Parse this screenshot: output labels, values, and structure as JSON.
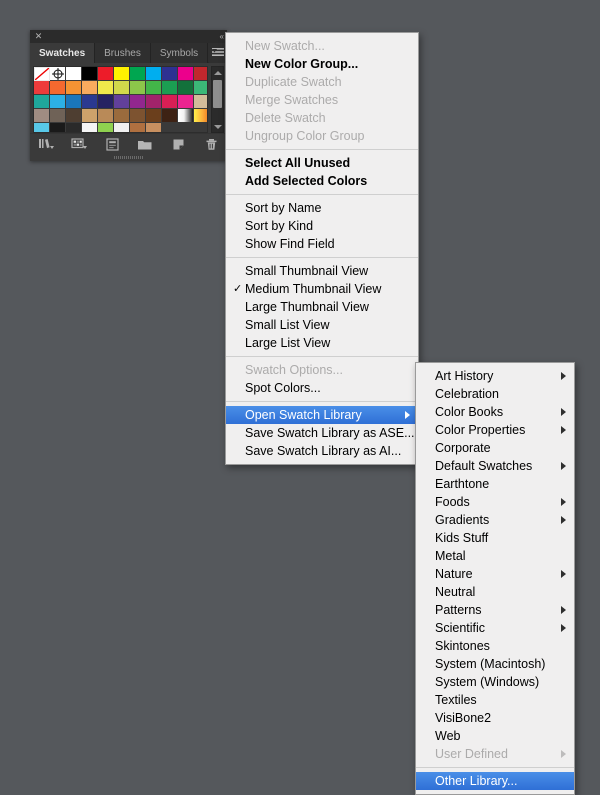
{
  "app": {
    "background_color": "#55585c"
  },
  "panel": {
    "title": "Swatches",
    "close_icon": "close-icon",
    "collapse_icon": "collapse-panel-icon",
    "collapse_glyph": "«",
    "close_glyph": "✕",
    "tabs": [
      {
        "label": "Swatches",
        "active": true
      },
      {
        "label": "Brushes",
        "active": false
      },
      {
        "label": "Symbols",
        "active": false
      }
    ],
    "menu_button_icon": "panel-menu-icon",
    "scrollbar": {
      "up_arrow_icon": "scroll-up-arrow-icon",
      "down_arrow_icon": "scroll-down-arrow-icon",
      "thumb_icon": "scrollbar-thumb"
    },
    "footer_icons": [
      {
        "name": "swatch-libraries-menu-icon"
      },
      {
        "name": "show-swatch-kinds-menu-icon"
      },
      {
        "name": "swatch-options-icon"
      },
      {
        "name": "new-color-group-icon"
      },
      {
        "name": "new-swatch-icon"
      },
      {
        "name": "delete-swatch-icon"
      }
    ],
    "swatches": [
      {
        "color": "#ffffff",
        "kind": "none",
        "selected": true
      },
      {
        "color": "#ffffff",
        "kind": "registration"
      },
      {
        "color": "#ffffff",
        "kind": "solid"
      },
      {
        "color": "#000000",
        "kind": "solid"
      },
      {
        "color": "#ed1c29",
        "kind": "solid"
      },
      {
        "color": "#fff100",
        "kind": "solid"
      },
      {
        "color": "#00a650",
        "kind": "solid"
      },
      {
        "color": "#00aeef",
        "kind": "solid"
      },
      {
        "color": "#2e3192",
        "kind": "solid"
      },
      {
        "color": "#ec008c",
        "kind": "solid"
      },
      {
        "color": "#c1272d",
        "kind": "solid"
      },
      {
        "color": "#ed3b3b",
        "kind": "solid"
      },
      {
        "color": "#f4692f",
        "kind": "solid"
      },
      {
        "color": "#f49333",
        "kind": "solid"
      },
      {
        "color": "#f8ab5e",
        "kind": "solid"
      },
      {
        "color": "#f0e94b",
        "kind": "solid"
      },
      {
        "color": "#d2d94b",
        "kind": "solid"
      },
      {
        "color": "#8cc64a",
        "kind": "solid"
      },
      {
        "color": "#43b649",
        "kind": "solid"
      },
      {
        "color": "#1b9e52",
        "kind": "solid"
      },
      {
        "color": "#13713b",
        "kind": "solid"
      },
      {
        "color": "#3bb878",
        "kind": "solid"
      },
      {
        "color": "#1fa79b",
        "kind": "solid"
      },
      {
        "color": "#2cb0e5",
        "kind": "solid"
      },
      {
        "color": "#1a76bb",
        "kind": "solid"
      },
      {
        "color": "#2b3990",
        "kind": "solid"
      },
      {
        "color": "#262262",
        "kind": "solid"
      },
      {
        "color": "#62409b",
        "kind": "solid"
      },
      {
        "color": "#92278f",
        "kind": "solid"
      },
      {
        "color": "#a2236b",
        "kind": "solid"
      },
      {
        "color": "#d81f55",
        "kind": "solid"
      },
      {
        "color": "#ec2490",
        "kind": "solid"
      },
      {
        "color": "#d3bc9a",
        "kind": "solid"
      },
      {
        "color": "#a08c82",
        "kind": "solid"
      },
      {
        "color": "#6f6257",
        "kind": "solid"
      },
      {
        "color": "#4e3e31",
        "kind": "solid"
      },
      {
        "color": "#cda26b",
        "kind": "solid"
      },
      {
        "color": "#b98a58",
        "kind": "solid"
      },
      {
        "color": "#9a6b3d",
        "kind": "solid"
      },
      {
        "color": "#7d5330",
        "kind": "solid"
      },
      {
        "color": "#6b3f1c",
        "kind": "solid"
      },
      {
        "color": "#3d2214",
        "kind": "solid"
      },
      {
        "color": "#ffffff",
        "kind": "gradient-white-black"
      },
      {
        "color": "#fbb03b",
        "kind": "gradient-orange"
      },
      {
        "color": "#58c8e8",
        "kind": "pattern"
      },
      {
        "color": "#1a1a1a",
        "kind": "pattern"
      },
      {
        "color": "#2a2a2a",
        "kind": "pattern"
      },
      {
        "color": "#f5f5f5",
        "kind": "pattern"
      },
      {
        "color": "#8fd14f",
        "kind": "pattern"
      },
      {
        "color": "#f0f0f0",
        "kind": "pattern"
      },
      {
        "color": "#b07040",
        "kind": "pattern"
      },
      {
        "color": "#c89060",
        "kind": "pattern"
      },
      {
        "color": "#3a3a3a",
        "kind": "pattern"
      },
      {
        "color": "#3a3a3a",
        "kind": "pattern"
      },
      {
        "color": "#3a3a3a",
        "kind": "pattern"
      }
    ]
  },
  "main_menu": {
    "items": [
      {
        "label": "New Swatch...",
        "state": "disabled",
        "type": "item"
      },
      {
        "label": "New Color Group...",
        "state": "bold",
        "type": "item"
      },
      {
        "label": "Duplicate Swatch",
        "state": "disabled",
        "type": "item"
      },
      {
        "label": "Merge Swatches",
        "state": "disabled",
        "type": "item"
      },
      {
        "label": "Delete Swatch",
        "state": "disabled",
        "type": "item"
      },
      {
        "label": "Ungroup Color Group",
        "state": "disabled",
        "type": "item"
      },
      {
        "type": "separator"
      },
      {
        "label": "Select All Unused",
        "state": "bold",
        "type": "item"
      },
      {
        "label": "Add Selected Colors",
        "state": "bold",
        "type": "item"
      },
      {
        "type": "separator"
      },
      {
        "label": "Sort by Name",
        "state": "normal",
        "type": "item"
      },
      {
        "label": "Sort by Kind",
        "state": "normal",
        "type": "item"
      },
      {
        "label": "Show Find Field",
        "state": "normal",
        "type": "item"
      },
      {
        "type": "separator"
      },
      {
        "label": "Small Thumbnail View",
        "state": "normal",
        "type": "item"
      },
      {
        "label": "Medium Thumbnail View",
        "state": "normal",
        "type": "item",
        "checked": true
      },
      {
        "label": "Large Thumbnail View",
        "state": "normal",
        "type": "item"
      },
      {
        "label": "Small List View",
        "state": "normal",
        "type": "item"
      },
      {
        "label": "Large List View",
        "state": "normal",
        "type": "item"
      },
      {
        "type": "separator"
      },
      {
        "label": "Swatch Options...",
        "state": "disabled",
        "type": "item"
      },
      {
        "label": "Spot Colors...",
        "state": "normal",
        "type": "item"
      },
      {
        "type": "separator"
      },
      {
        "label": "Open Swatch Library",
        "state": "highlight",
        "type": "item",
        "submenu": true
      },
      {
        "label": "Save Swatch Library as ASE...",
        "state": "normal",
        "type": "item"
      },
      {
        "label": "Save Swatch Library as AI...",
        "state": "normal",
        "type": "item"
      }
    ]
  },
  "submenu": {
    "items": [
      {
        "label": "Art History",
        "state": "normal",
        "submenu": true
      },
      {
        "label": "Celebration",
        "state": "normal",
        "submenu": false
      },
      {
        "label": "Color Books",
        "state": "normal",
        "submenu": true
      },
      {
        "label": "Color Properties",
        "state": "normal",
        "submenu": true
      },
      {
        "label": "Corporate",
        "state": "normal",
        "submenu": false
      },
      {
        "label": "Default Swatches",
        "state": "normal",
        "submenu": true
      },
      {
        "label": "Earthtone",
        "state": "normal",
        "submenu": false
      },
      {
        "label": "Foods",
        "state": "normal",
        "submenu": true
      },
      {
        "label": "Gradients",
        "state": "normal",
        "submenu": true
      },
      {
        "label": "Kids Stuff",
        "state": "normal",
        "submenu": false
      },
      {
        "label": "Metal",
        "state": "normal",
        "submenu": false
      },
      {
        "label": "Nature",
        "state": "normal",
        "submenu": true
      },
      {
        "label": "Neutral",
        "state": "normal",
        "submenu": false
      },
      {
        "label": "Patterns",
        "state": "normal",
        "submenu": true
      },
      {
        "label": "Scientific",
        "state": "normal",
        "submenu": true
      },
      {
        "label": "Skintones",
        "state": "normal",
        "submenu": false
      },
      {
        "label": "System (Macintosh)",
        "state": "normal",
        "submenu": false
      },
      {
        "label": "System (Windows)",
        "state": "normal",
        "submenu": false
      },
      {
        "label": "Textiles",
        "state": "normal",
        "submenu": false
      },
      {
        "label": "VisiBone2",
        "state": "normal",
        "submenu": false
      },
      {
        "label": "Web",
        "state": "normal",
        "submenu": false
      },
      {
        "label": "User Defined",
        "state": "disabled",
        "submenu": true
      },
      {
        "type": "separator"
      },
      {
        "label": "Other Library...",
        "state": "highlight",
        "submenu": false
      }
    ]
  },
  "colors": {
    "menu_background": "#f0efef",
    "menu_text": "#000000",
    "menu_disabled_text": "#acabab",
    "highlight_top": "#4a8fe8",
    "highlight_bottom": "#2f6fd6",
    "highlight_text": "#ffffff",
    "panel_background": "#3a3a3a",
    "panel_titlebar": "#2b2b2b",
    "panel_tabbar": "#2f2f2f",
    "panel_active_tab_text": "#e8e8e8",
    "panel_inactive_tab_text": "#a8a8a8"
  }
}
